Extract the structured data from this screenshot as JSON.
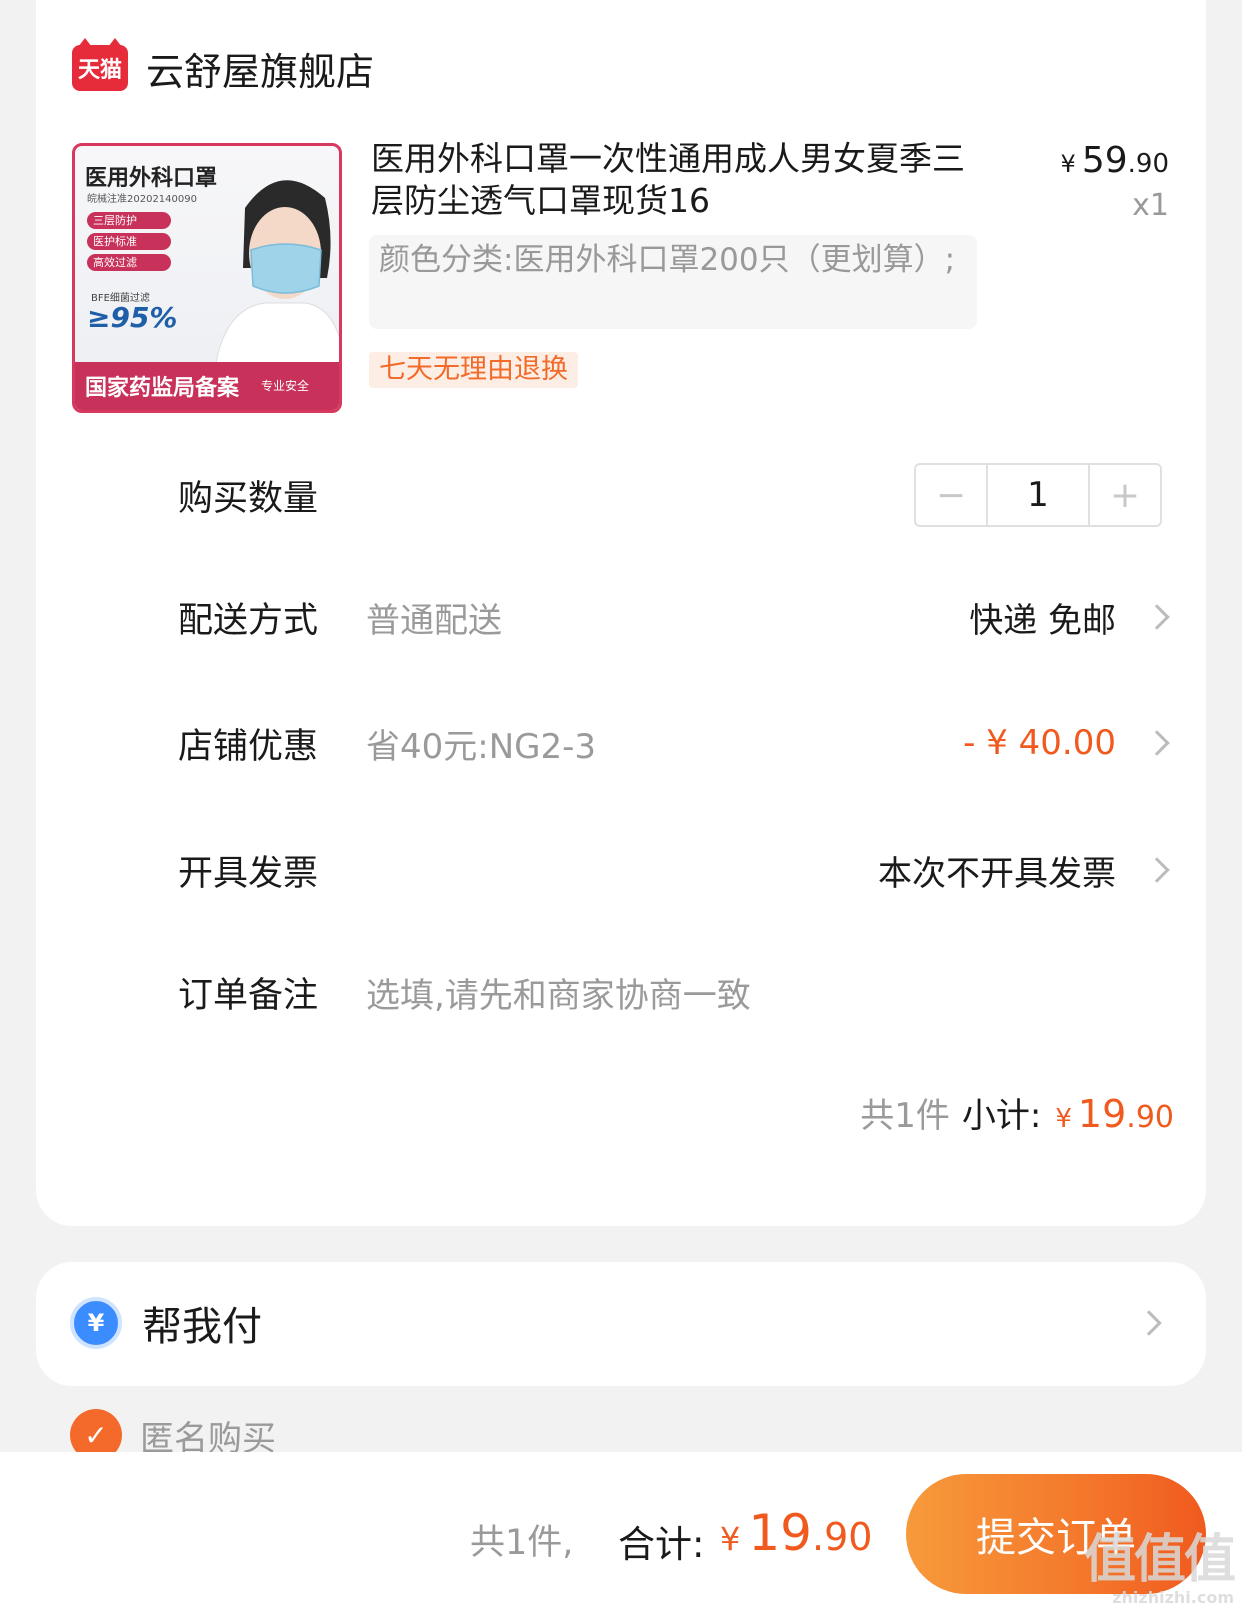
{
  "store": {
    "logo_text": "天猫",
    "name": "云舒屋旗舰店"
  },
  "product": {
    "image": {
      "title": "医用外科口罩",
      "sub": "皖械注准20202140090",
      "tags": [
        "三层防护",
        "医护标准",
        "高效过滤"
      ],
      "bfe_label": "BFE细菌过滤",
      "bfe_value": "≥95%",
      "bottom_text": "国家药监局备案",
      "bottom_small": "专业安全"
    },
    "title": "医用外科口罩一次性通用成人男女夏季三层防尘透气口罩现货16",
    "price": {
      "symbol": "¥",
      "int": "59",
      "dec": ".90"
    },
    "quantity_label": "x1",
    "spec": "颜色分类:医用外科口罩200只（更划算）;",
    "return_badge": "七天无理由退换"
  },
  "rows": {
    "qty": {
      "label": "购买数量",
      "minus": "−",
      "value": "1",
      "plus": "+"
    },
    "delivery": {
      "label": "配送方式",
      "value": "普通配送",
      "right": "快递 免邮"
    },
    "discount": {
      "label": "店铺优惠",
      "value": "省40元:NG2-3",
      "right": "- ¥ 40.00"
    },
    "invoice": {
      "label": "开具发票",
      "right": "本次不开具发票"
    },
    "note": {
      "label": "订单备注",
      "placeholder": "选填,请先和商家协商一致"
    }
  },
  "subtotal": {
    "count": "共1件",
    "label": "小计:",
    "symbol": "¥",
    "int": "19",
    "dec": ".90"
  },
  "pay_for_me": {
    "icon_text": "¥",
    "label": "帮我付"
  },
  "anonymous": {
    "icon_text": "✓",
    "label": "匿名购买"
  },
  "bottom_bar": {
    "count": "共1件,",
    "label": "合计:",
    "symbol": "¥",
    "int": "19",
    "dec": ".90",
    "submit": "提交订单"
  },
  "watermark": {
    "big": "值值值",
    "small": "zhizhizhi.com"
  },
  "colors": {
    "accent": "#f05a1e",
    "tmall_red": "#e62c3a",
    "pay_blue": "#3b8cff",
    "background": "#f2f2f2"
  }
}
